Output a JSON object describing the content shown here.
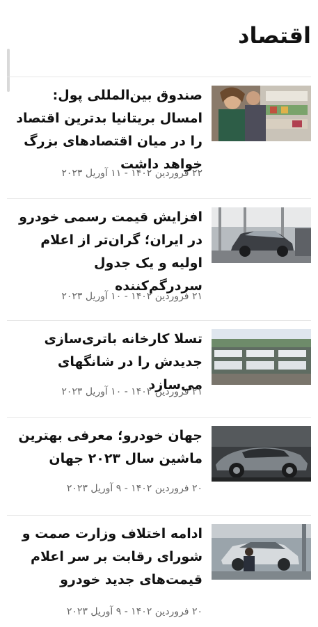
{
  "section": {
    "title": "اقتصاد"
  },
  "articles": [
    {
      "headline": "صندوق بین‌المللی پول: امسال بریتانیا بدترین اقتصاد را در میان اقتصادهای بزرگ خواهد داشت",
      "date": "۲۲ فروردین ۱۴۰۲ - ۱۱ آوریل ۲۰۲۳",
      "image_icon": "grocery-shopping-photo"
    },
    {
      "headline": "افزایش قیمت رسمی خودرو در ایران؛ گران‌تر از اعلام اولیه و یک جدول سردرگم‌کننده",
      "date": "۲۱ فروردین ۱۴۰۲ - ۱۰ آوریل ۲۰۲۳",
      "image_icon": "car-factory-photo"
    },
    {
      "headline": "تسلا کارخانه باتری‌سازی جدیدش را در شانگهای می‌سازد",
      "date": "۲۱ فروردین ۱۴۰۲ - ۱۰ آوریل ۲۰۲۳",
      "image_icon": "battery-factory-photo"
    },
    {
      "headline": "جهان خودرو؛ معرفی بهترین ماشین سال ۲۰۲۳ جهان",
      "date": "۲۰ فروردین ۱۴۰۲ - ۹ آوریل ۲۰۲۳",
      "image_icon": "grey-car-photo"
    },
    {
      "headline": "ادامه اختلاف وزارت صمت و شورای رقابت بر سر اعلام قیمت‌های جدید خودرو",
      "date": "۲۰ فروردین ۱۴۰۲ - ۹ آوریل ۲۰۲۳",
      "image_icon": "car-assembly-photo"
    }
  ]
}
